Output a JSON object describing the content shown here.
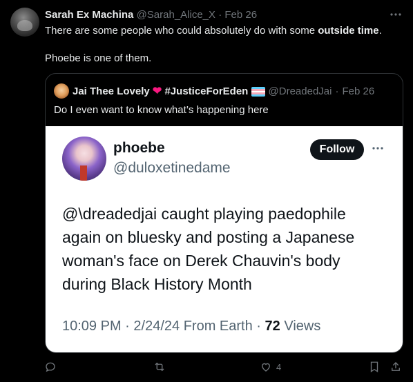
{
  "tweet": {
    "name": "Sarah Ex Machina",
    "handle": "@Sarah_Alice_X",
    "separator": "·",
    "date": "Feb 26",
    "text_line1_pre": "There are some people who could absolutely do with some ",
    "text_line1_bold": "outside time",
    "text_line1_post": ".",
    "text_line2": "Phoebe is one of them."
  },
  "quote": {
    "name_pre": "Jai Thee Lovely",
    "heart": "❤",
    "hashtag": "#JusticeForEden",
    "handle": "@DreadedJai",
    "separator": "·",
    "date": "Feb 26",
    "text": "Do I even want to know what’s happening here",
    "flag_colors": [
      "#5bcefa",
      "#f5a9b8",
      "#ffffff",
      "#f5a9b8",
      "#5bcefa"
    ]
  },
  "card": {
    "name": "phoebe",
    "handle": "@duloxetinedame",
    "follow_label": "Follow",
    "body": "@\\dreadedjai caught playing paedophile again on bluesky and posting a Japanese woman's face on Derek Chauvin's body during Black History Month",
    "time": "10:09 PM",
    "date": "2/24/24",
    "location": "From Earth",
    "views_count": "72",
    "views_label": "Views"
  },
  "actions": {
    "reply_icon": "reply-icon",
    "repost_icon": "repost-icon",
    "like_icon": "heart-icon",
    "like_count": "4",
    "bookmark_icon": "bookmark-icon",
    "share_icon": "share-icon"
  },
  "colors": {
    "background": "#000000",
    "text": "#e7e9ea",
    "muted": "#71767b",
    "border": "#2f3336",
    "heart": "#f91880"
  }
}
